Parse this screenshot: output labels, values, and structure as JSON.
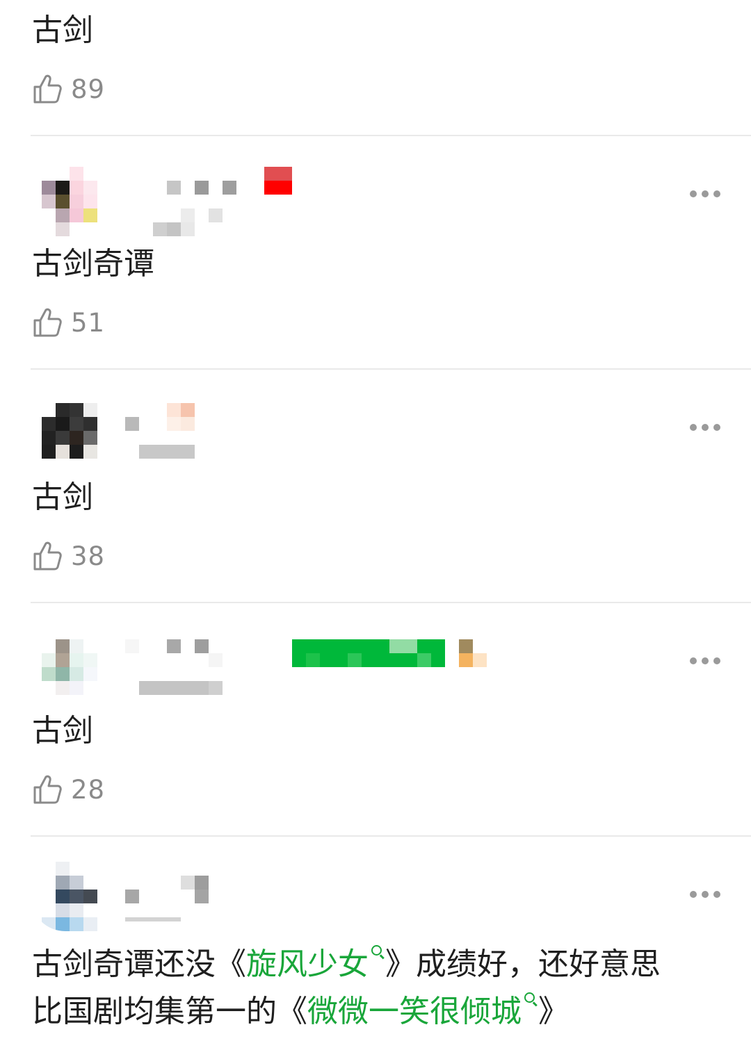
{
  "comments": [
    {
      "text": "古剑",
      "likes": "89"
    },
    {
      "text": "古剑奇谭",
      "likes": "51"
    },
    {
      "text": "古剑",
      "likes": "38"
    },
    {
      "text": "古剑",
      "likes": "28"
    }
  ],
  "last_comment": {
    "line1_a": "古剑奇谭还没《",
    "link1": "旋风少女",
    "line1_b": "》成绩好，还好意思",
    "line2_a": "比国剧均集第一的《",
    "link2": "微微一笑很倾城",
    "line2_b": "》"
  },
  "colors": {
    "link_green": "#19a63a",
    "divider": "#e9e9e9",
    "muted_text": "#8a8a8a"
  },
  "icons": {
    "like": "thumbs-up-outline-icon",
    "more": "more-dots-icon",
    "search": "search-icon"
  }
}
